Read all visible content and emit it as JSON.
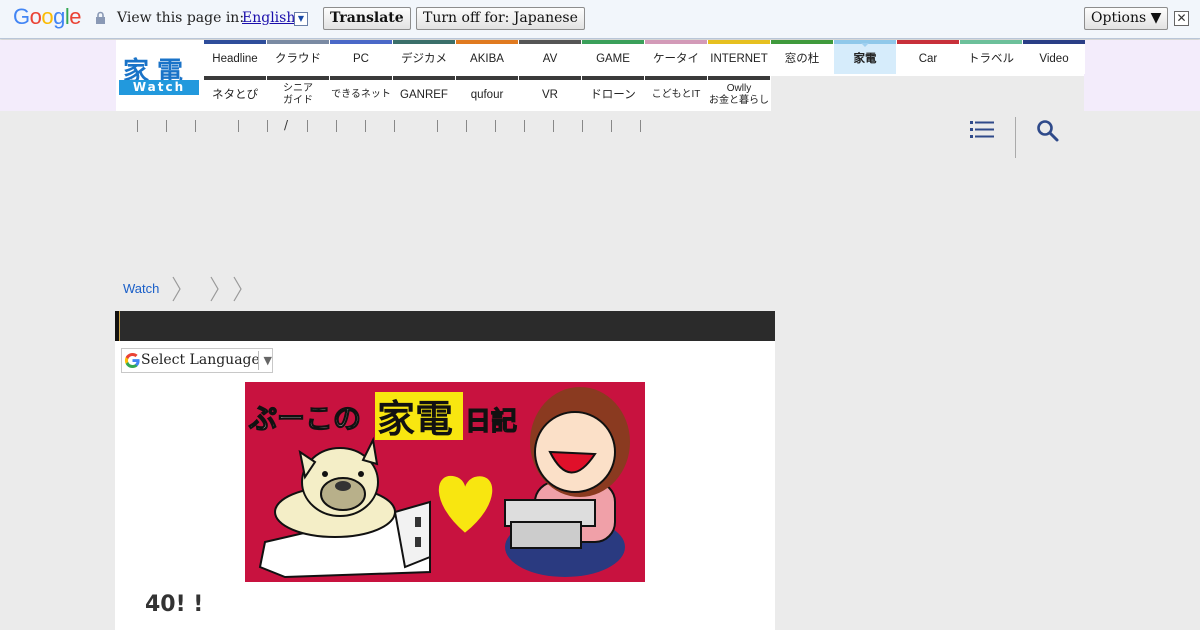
{
  "translate_bar": {
    "logo_letters": [
      "G",
      "o",
      "o",
      "g",
      "l",
      "e"
    ],
    "logo_colors": [
      "#4285f4",
      "#ea4335",
      "#fbbc05",
      "#4285f4",
      "#34a853",
      "#ea4335"
    ],
    "view_text": "View this page in:",
    "language": "English",
    "translate_button": "Translate",
    "turn_off_button": "Turn off for: Japanese",
    "options_button": "Options ▼",
    "close_glyph": "✕"
  },
  "site": {
    "logo_kanji": "家電",
    "logo_watch": "Watch"
  },
  "nav": {
    "row1": [
      {
        "label": "Headline",
        "color": "#2e4d9b"
      },
      {
        "label": "クラウド",
        "color": "#7a8aa3"
      },
      {
        "label": "PC",
        "color": "#4a68c8"
      },
      {
        "label": "デジカメ",
        "color": "#3a6f6a"
      },
      {
        "label": "AKIBA",
        "color": "#e07a20"
      },
      {
        "label": "AV",
        "color": "#555555"
      },
      {
        "label": "GAME",
        "color": "#3aa05a"
      },
      {
        "label": "ケータイ",
        "color": "#d39ab8"
      },
      {
        "label": "INTERNET",
        "color": "#e6c020"
      },
      {
        "label": "窓の杜",
        "color": "#3f9a3c"
      },
      {
        "label": "家電",
        "color": "#8fc8ea",
        "active": true
      },
      {
        "label": "Car",
        "color": "#c8303a"
      },
      {
        "label": "トラベル",
        "color": "#6cc09a"
      },
      {
        "label": "Video",
        "color": "#2a3e86"
      }
    ],
    "row2": [
      {
        "label": "ネタとぴ",
        "color": "#3a3a3a"
      },
      {
        "label": "シニア\nガイド",
        "color": "#3a3a3a",
        "small": true
      },
      {
        "label": "できるネット",
        "color": "#3a3a3a",
        "small": true
      },
      {
        "label": "GANREF",
        "color": "#3a3a3a"
      },
      {
        "label": "qufour",
        "color": "#3a3a3a"
      },
      {
        "label": "VR",
        "color": "#3a3a3a"
      },
      {
        "label": "ドローン",
        "color": "#3a3a3a"
      },
      {
        "label": "こどもとIT",
        "color": "#3a3a3a",
        "small": true
      },
      {
        "label": "Owlly\nお金と暮らし",
        "color": "#3a3a3a",
        "small": true
      }
    ]
  },
  "subnav": {
    "slash": "/"
  },
  "breadcrumb": {
    "root": "Watch"
  },
  "translate_widget": {
    "label": "Select Language",
    "arrow": "▼"
  },
  "banner": {
    "text_left": "ぷーこの",
    "text_mid": "家電",
    "text_right": "日記",
    "bg_color": "#c8123f",
    "highlight_color": "#f8e610"
  },
  "article": {
    "title": "40! !"
  }
}
